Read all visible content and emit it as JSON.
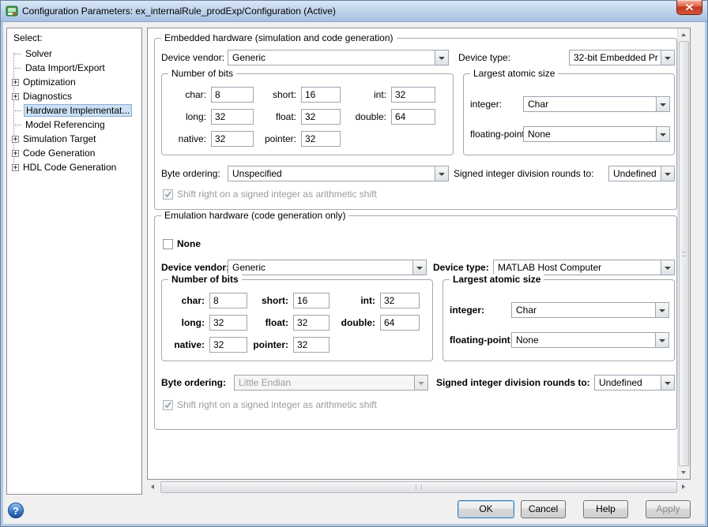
{
  "window": {
    "title": "Configuration Parameters: ex_internalRule_prodExp/Configuration (Active)"
  },
  "icons": {
    "help_glyph": "?"
  },
  "colors": {
    "titlebar_top": "#dae7f6",
    "titlebar_bottom": "#a7c0e2",
    "close_button_red": "#c23a21",
    "tree_selection_bg": "#cce0f5",
    "disabled_text": "#9b9b9b",
    "groupbox_border": "#a9a9a9"
  },
  "sidebar": {
    "select_label": "Select:",
    "items": [
      {
        "label": "Solver",
        "expandable": false,
        "selected": false
      },
      {
        "label": "Data Import/Export",
        "expandable": false,
        "selected": false
      },
      {
        "label": "Optimization",
        "expandable": true,
        "selected": false
      },
      {
        "label": "Diagnostics",
        "expandable": true,
        "selected": false
      },
      {
        "label": "Hardware Implementat...",
        "expandable": false,
        "selected": true
      },
      {
        "label": "Model Referencing",
        "expandable": false,
        "selected": false
      },
      {
        "label": "Simulation Target",
        "expandable": true,
        "selected": false
      },
      {
        "label": "Code Generation",
        "expandable": true,
        "selected": false
      },
      {
        "label": "HDL Code Generation",
        "expandable": true,
        "selected": false
      }
    ]
  },
  "embedded": {
    "group_title": "Embedded hardware (simulation and code generation)",
    "device_vendor_label": "Device vendor:",
    "device_vendor_value": "Generic",
    "device_type_label": "Device type:",
    "device_type_value": "32-bit Embedded Pr",
    "number_of_bits": {
      "title": "Number of bits",
      "char_label": "char:",
      "char_value": "8",
      "short_label": "short:",
      "short_value": "16",
      "int_label": "int:",
      "int_value": "32",
      "long_label": "long:",
      "long_value": "32",
      "float_label": "float:",
      "float_value": "32",
      "double_label": "double:",
      "double_value": "64",
      "native_label": "native:",
      "native_value": "32",
      "pointer_label": "pointer:",
      "pointer_value": "32"
    },
    "largest_atomic_size": {
      "title": "Largest atomic size",
      "integer_label": "integer:",
      "integer_value": "Char",
      "floating_point_label": "floating-point:",
      "floating_point_value": "None"
    },
    "byte_ordering_label": "Byte ordering:",
    "byte_ordering_value": "Unspecified",
    "signed_division_label": "Signed integer division rounds to:",
    "signed_division_value": "Undefined",
    "shift_right_label": "Shift right on a signed integer as arithmetic shift"
  },
  "emulation": {
    "group_title": "Emulation hardware (code generation only)",
    "none_label": "None",
    "device_vendor_label": "Device vendor:",
    "device_vendor_value": "Generic",
    "device_type_label": "Device type:",
    "device_type_value": "MATLAB Host Computer",
    "number_of_bits": {
      "title": "Number of bits",
      "char_label": "char:",
      "char_value": "8",
      "short_label": "short:",
      "short_value": "16",
      "int_label": "int:",
      "int_value": "32",
      "long_label": "long:",
      "long_value": "32",
      "float_label": "float:",
      "float_value": "32",
      "double_label": "double:",
      "double_value": "64",
      "native_label": "native:",
      "native_value": "32",
      "pointer_label": "pointer:",
      "pointer_value": "32"
    },
    "largest_atomic_size": {
      "title": "Largest atomic size",
      "integer_label": "integer:",
      "integer_value": "Char",
      "floating_point_label": "floating-point:",
      "floating_point_value": "None"
    },
    "byte_ordering_label": "Byte ordering:",
    "byte_ordering_value": "Little Endian",
    "signed_division_label": "Signed integer division rounds to:",
    "signed_division_value": "Undefined",
    "shift_right_label": "Shift right on a signed integer as arithmetic shift"
  },
  "footer": {
    "ok_label": "OK",
    "cancel_label": "Cancel",
    "help_label": "Help",
    "apply_label": "Apply"
  }
}
